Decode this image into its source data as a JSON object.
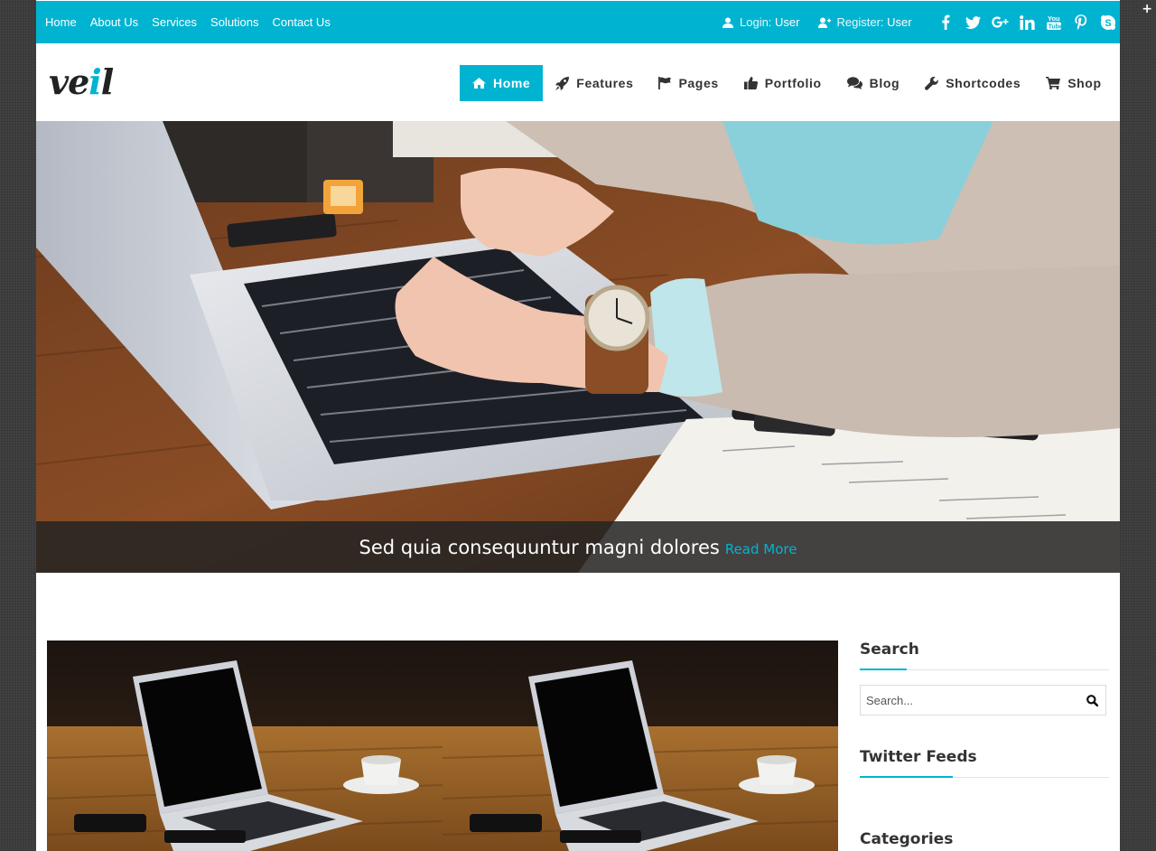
{
  "top_nav": [
    "Home",
    "About Us",
    "Services",
    "Solutions",
    "Contact Us"
  ],
  "user": {
    "login_label": "Login:",
    "login_user": "User",
    "register_label": "Register:",
    "register_user": "User"
  },
  "social_icons": [
    "facebook-icon",
    "twitter-icon",
    "google-plus-icon",
    "linkedin-icon",
    "youtube-icon",
    "pinterest-icon",
    "skype-icon"
  ],
  "logo": {
    "text_before": "ve",
    "accent": "i",
    "text_after": "l"
  },
  "main_nav": [
    {
      "label": "Home",
      "icon": "home-icon",
      "active": true
    },
    {
      "label": "Features",
      "icon": "rocket-icon",
      "active": false
    },
    {
      "label": "Pages",
      "icon": "flag-icon",
      "active": false
    },
    {
      "label": "Portfolio",
      "icon": "thumbs-up-icon",
      "active": false
    },
    {
      "label": "Blog",
      "icon": "comments-icon",
      "active": false
    },
    {
      "label": "Shortcodes",
      "icon": "wrench-icon",
      "active": false
    },
    {
      "label": "Shop",
      "icon": "cart-icon",
      "active": false
    }
  ],
  "hero": {
    "caption": "Sed quia consequuntur magni dolores",
    "read_more": "Read More"
  },
  "sidebar": {
    "search_title": "Search",
    "search_placeholder": "Search...",
    "twitter_title": "Twitter Feeds",
    "categories_title": "Categories"
  },
  "colors": {
    "accent": "#00b4d1",
    "background": "#3d3d3d"
  },
  "corner_glyph": "+"
}
